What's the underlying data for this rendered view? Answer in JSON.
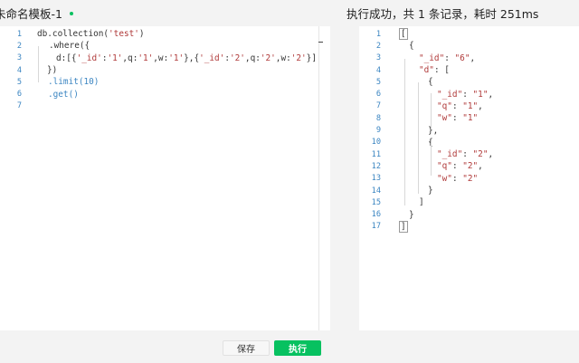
{
  "left_header": {
    "title": "未命名模板-1"
  },
  "right_header": {
    "status": "执行成功，共 1 条记录，耗时 251ms"
  },
  "editor": {
    "lines": [
      {
        "n": "1",
        "tokens": [
          "db.collection(",
          "'test'",
          ")"
        ]
      },
      {
        "n": "2",
        "tokens": [
          ".where({"
        ]
      },
      {
        "n": "3",
        "tokens": [
          "d:[{",
          "'_id'",
          ":",
          "'1'",
          ",q:",
          "'1'",
          ",w:",
          "'1'",
          "},{",
          "'_id'",
          ":",
          "'2'",
          ",q:",
          "'2'",
          ",w:",
          "'2'",
          "}]"
        ]
      },
      {
        "n": "4",
        "tokens": [
          "})"
        ]
      },
      {
        "n": "5",
        "tokens": [
          ".limit(10)"
        ]
      },
      {
        "n": "6",
        "tokens": [
          ".get()"
        ]
      },
      {
        "n": "7",
        "tokens": [
          ""
        ]
      }
    ]
  },
  "result": {
    "lines": [
      {
        "n": "1",
        "text": "["
      },
      {
        "n": "2",
        "text": "{"
      },
      {
        "n": "3",
        "key": "\"_id\"",
        "val": "\"6\"",
        "tail": ","
      },
      {
        "n": "4",
        "key": "\"d\"",
        "tail": ": ["
      },
      {
        "n": "5",
        "text": "{"
      },
      {
        "n": "6",
        "key": "\"_id\"",
        "val": "\"1\"",
        "tail": ","
      },
      {
        "n": "7",
        "key": "\"q\"",
        "val": "\"1\"",
        "tail": ","
      },
      {
        "n": "8",
        "key": "\"w\"",
        "val": "\"1\"",
        "tail": ""
      },
      {
        "n": "9",
        "text": "},"
      },
      {
        "n": "10",
        "text": "{"
      },
      {
        "n": "11",
        "key": "\"_id\"",
        "val": "\"2\"",
        "tail": ","
      },
      {
        "n": "12",
        "key": "\"q\"",
        "val": "\"2\"",
        "tail": ","
      },
      {
        "n": "13",
        "key": "\"w\"",
        "val": "\"2\"",
        "tail": ""
      },
      {
        "n": "14",
        "text": "}"
      },
      {
        "n": "15",
        "text": "]"
      },
      {
        "n": "16",
        "text": "}"
      },
      {
        "n": "17",
        "text": "]"
      }
    ]
  },
  "buttons": {
    "save": "保存",
    "run": "执行"
  },
  "colors": {
    "accent": "#07c160",
    "line_number": "#3c86c2",
    "string": "#b03a3a"
  }
}
